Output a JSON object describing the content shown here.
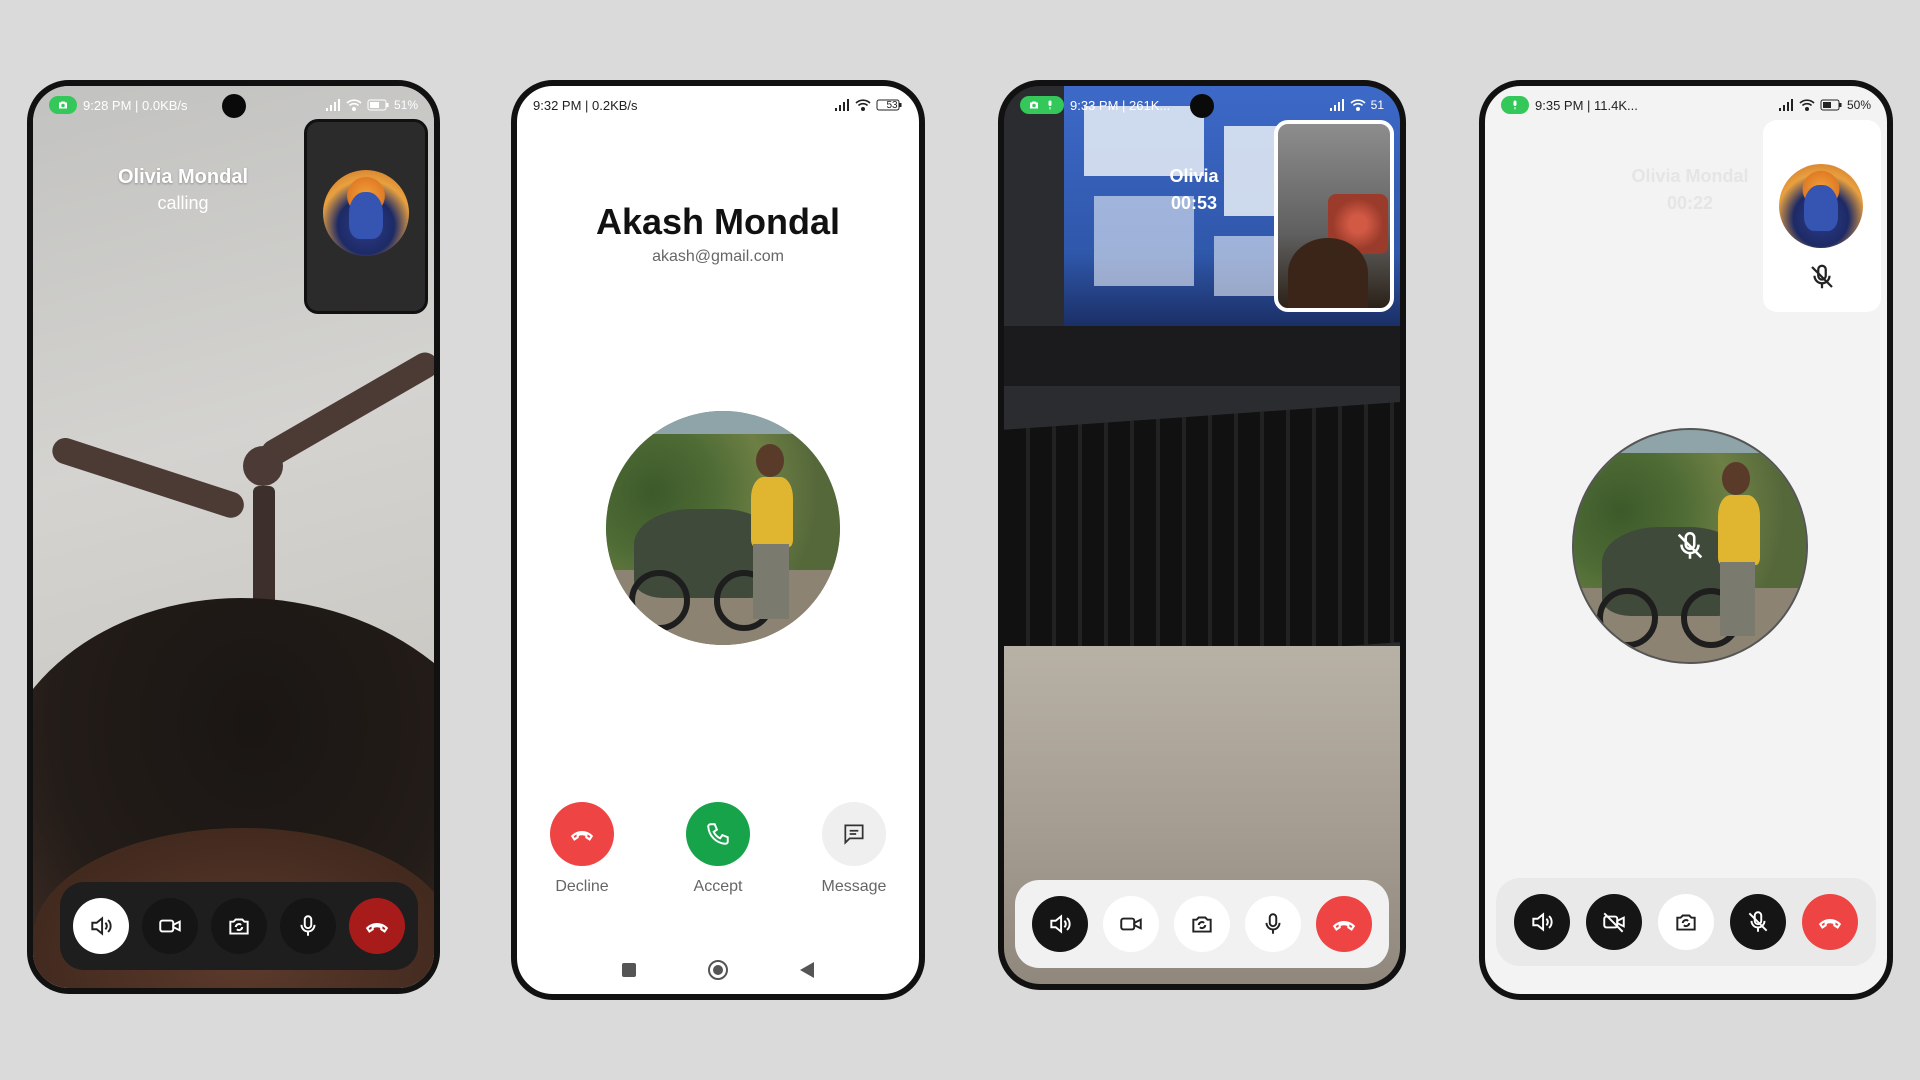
{
  "screens": [
    {
      "status": {
        "time": "9:28 PM | 0.0KB/s",
        "battery": "51%"
      },
      "caller_name": "Olivia Mondal",
      "caller_status": "calling",
      "controls": [
        "speaker",
        "video",
        "flip-camera",
        "mic",
        "end-call"
      ]
    },
    {
      "status": {
        "time": "9:32 PM | 0.2KB/s",
        "battery": "53"
      },
      "name": "Akash Mondal",
      "email": "akash@gmail.com",
      "actions": [
        {
          "label": "Decline",
          "color": "#ef4444"
        },
        {
          "label": "Accept",
          "color": "#16a34a"
        },
        {
          "label": "Message",
          "color": "#efefef"
        }
      ]
    },
    {
      "status": {
        "time": "9:33 PM | 261K...",
        "battery": "51"
      },
      "caller_name": "Olivia",
      "timer": "00:53",
      "controls": [
        "speaker",
        "video",
        "flip-camera",
        "mic",
        "end-call"
      ]
    },
    {
      "status": {
        "time": "9:35 PM | 11.4K...",
        "battery": "50%"
      },
      "caller_name": "Olivia Mondal",
      "timer": "00:22",
      "controls": [
        "speaker",
        "video-off",
        "flip-camera",
        "mic-off",
        "end-call"
      ]
    }
  ],
  "colors": {
    "background": "#dadada",
    "end_call_red": "#ef4444",
    "accept_green": "#16a34a",
    "status_pill_green": "#34c759"
  },
  "icons": [
    "camera-icon",
    "mic-icon",
    "signal-icon",
    "wifi-icon",
    "battery-icon",
    "speaker-icon",
    "video-icon",
    "video-off-icon",
    "flip-camera-icon",
    "mic-off-icon",
    "end-call-icon",
    "phone-icon",
    "message-icon"
  ]
}
